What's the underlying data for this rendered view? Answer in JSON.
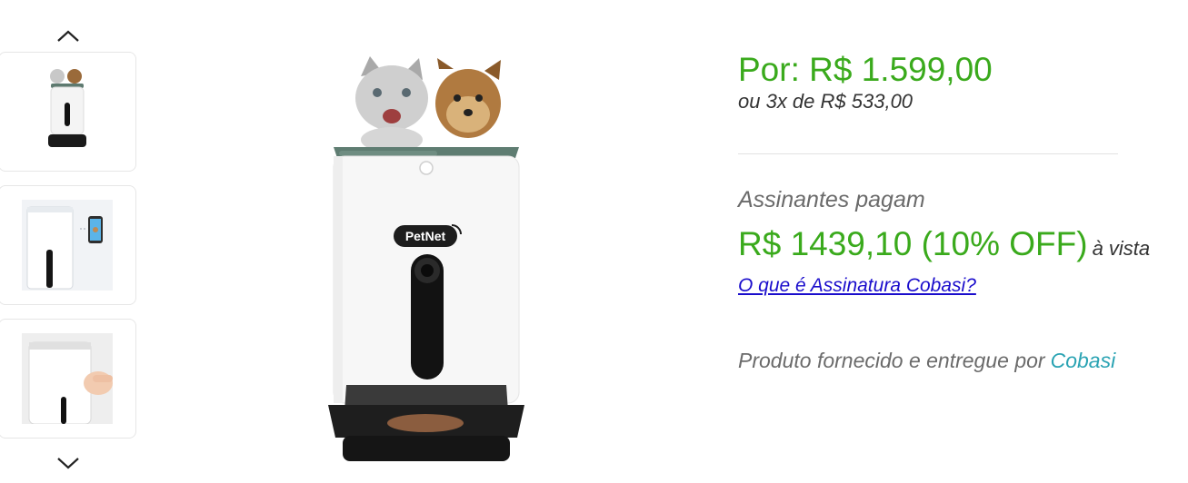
{
  "gallery": {
    "prev_icon": "chevron-up-icon",
    "next_icon": "chevron-down-icon",
    "main_brand_label": "PetNet"
  },
  "product": {
    "price": "Por: R$ 1.599,00",
    "installments": "ou 3x de R$ 533,00",
    "subscription_label": "Assinantes pagam",
    "subscription_price": "R$ 1439,10 (10% OFF)",
    "subscription_price_suffix": "à vista",
    "subscription_link": "O que é Assinatura Cobasi?",
    "supplier_prefix": "Produto fornecido e entregue por",
    "supplier_name": "Cobasi"
  },
  "colors": {
    "price_green": "#3aaa1c",
    "supplier_teal": "#2aa3b3",
    "link_blue": "#1a0dcc"
  }
}
